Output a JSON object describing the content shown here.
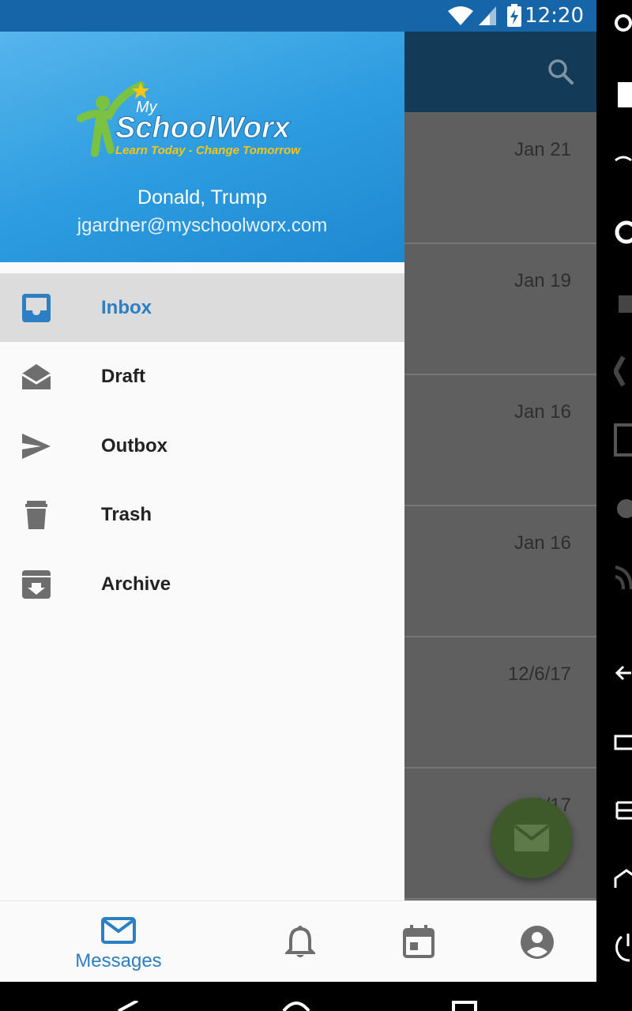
{
  "status_bar": {
    "time": "12:20"
  },
  "drawer": {
    "user_name": "Donald, Trump",
    "user_email": "jgardner@myschoolworx.com",
    "logo": {
      "top": "My",
      "brand": "SchoolWorx",
      "tagline": "Learn Today - Change Tomorrow"
    },
    "items": [
      {
        "label": "Inbox",
        "icon": "inbox-icon",
        "active": true
      },
      {
        "label": "Draft",
        "icon": "drafts-icon",
        "active": false
      },
      {
        "label": "Outbox",
        "icon": "send-icon",
        "active": false
      },
      {
        "label": "Trash",
        "icon": "trash-icon",
        "active": false
      },
      {
        "label": "Archive",
        "icon": "archive-icon",
        "active": false
      }
    ]
  },
  "messages": {
    "dates": [
      "Jan 21",
      "Jan 19",
      "Jan 16",
      "Jan 16",
      "12/6/17",
      "11/17"
    ]
  },
  "bottom_nav": {
    "messages_label": "Messages",
    "icons": [
      "mail-icon",
      "bell-icon",
      "calendar-icon",
      "account-icon"
    ]
  },
  "colors": {
    "accent": "#2b7fc2",
    "status_bar": "#1565a8",
    "app_bar": "#133a56",
    "fab": "#3f5a2a"
  }
}
